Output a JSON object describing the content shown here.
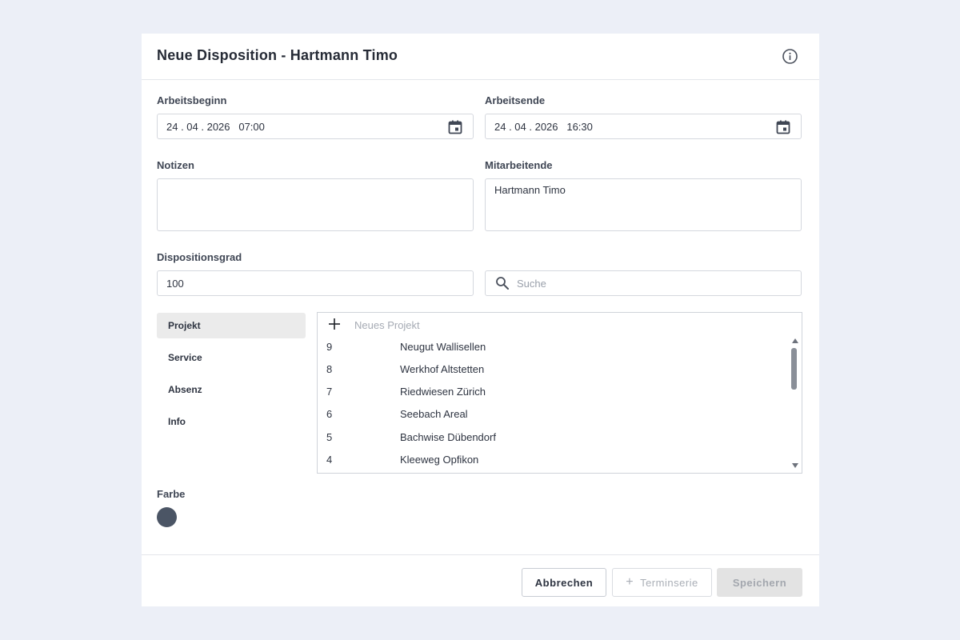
{
  "dialog": {
    "title": "Neue Disposition - Hartmann Timo"
  },
  "form": {
    "start_label": "Arbeitsbeginn",
    "start_value": "24 . 04 . 2026   07:00",
    "end_label": "Arbeitsende",
    "end_value": "24 . 04 . 2026   16:30",
    "notes_label": "Notizen",
    "notes_value": "",
    "staff_label": "Mitarbeitende",
    "staff_value": "Hartmann Timo",
    "degree_label": "Dispositionsgrad",
    "degree_value": "100",
    "search_placeholder": "Suche",
    "color_label": "Farbe",
    "color_value": "#4b5565"
  },
  "tabs": [
    {
      "label": "Projekt",
      "active": true
    },
    {
      "label": "Service",
      "active": false
    },
    {
      "label": "Absenz",
      "active": false
    },
    {
      "label": "Info",
      "active": false
    }
  ],
  "projects": {
    "new_label": "Neues Projekt",
    "items": [
      {
        "num": "9",
        "name": "Neugut Wallisellen"
      },
      {
        "num": "8",
        "name": "Werkhof Altstetten"
      },
      {
        "num": "7",
        "name": "Riedwiesen Zürich"
      },
      {
        "num": "6",
        "name": "Seebach Areal"
      },
      {
        "num": "5",
        "name": "Bachwise Dübendorf"
      },
      {
        "num": "4",
        "name": "Kleeweg Opfikon"
      }
    ]
  },
  "footer": {
    "cancel_label": "Abbrechen",
    "series_label": "Terminserie",
    "save_label": "Speichern"
  },
  "icons": {
    "info": "info-icon",
    "calendar": "calendar-icon",
    "search": "search-icon",
    "plus": "plus-icon"
  }
}
